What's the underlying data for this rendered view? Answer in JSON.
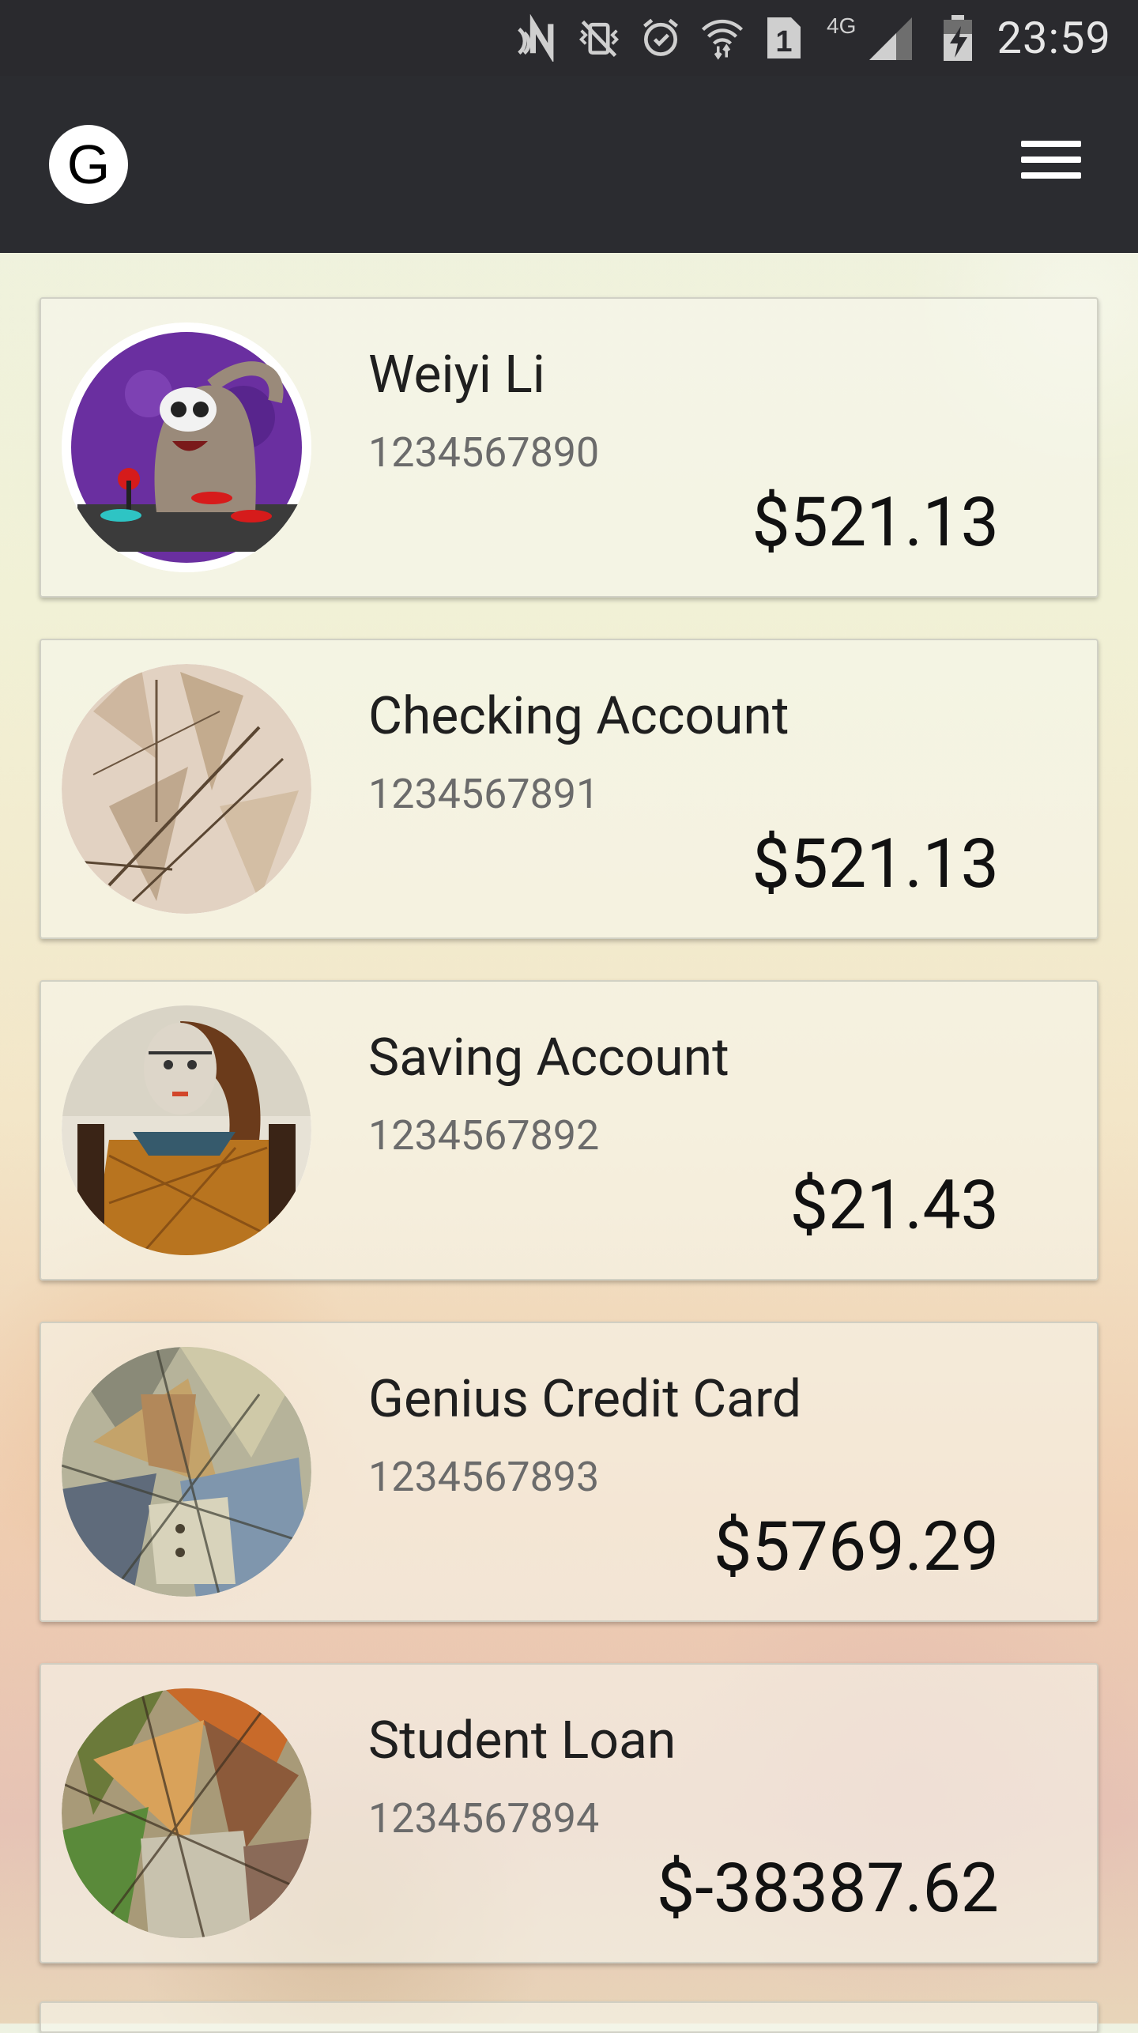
{
  "status_bar": {
    "time": "23:59",
    "network_label": "4G",
    "sim_label": "1",
    "icons": [
      "nfc-icon",
      "vibrate-off-icon",
      "alarm-icon",
      "wifi-icon",
      "sim-icon",
      "signal-icon",
      "battery-charging-icon"
    ]
  },
  "app_bar": {
    "logo_letter": "G",
    "menu_icon": "hamburger-menu-icon"
  },
  "accounts": [
    {
      "name": "Weiyi Li",
      "number": "1234567890",
      "balance": "$521.13",
      "avatar": "cartoon-raccoon-avatar"
    },
    {
      "name": "Checking Account",
      "number": "1234567891",
      "balance": "$521.13",
      "avatar": "cubist-sketch-avatar"
    },
    {
      "name": "Saving Account",
      "number": "1234567892",
      "balance": "$21.43",
      "avatar": "portrait-girl-painting-avatar"
    },
    {
      "name": "Genius Credit Card",
      "number": "1234567893",
      "balance": "$5769.29",
      "avatar": "cubist-portrait-avatar"
    },
    {
      "name": "Student Loan",
      "number": "1234567894",
      "balance": "$-38387.62",
      "avatar": "cubist-figure-avatar"
    }
  ]
}
